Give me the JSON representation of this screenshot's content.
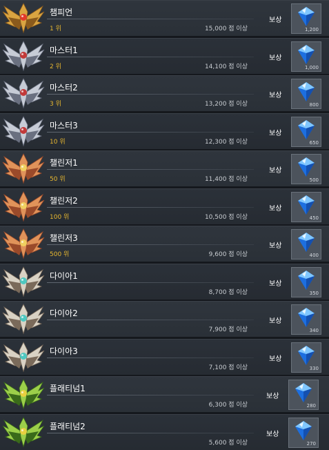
{
  "rows": [
    {
      "name": "챔피언",
      "rank": "1 위",
      "score": "15,000 점 이상",
      "reward": "보상",
      "qty": "1,200",
      "tier": "champion"
    },
    {
      "name": "마스터1",
      "rank": "2 위",
      "score": "14,100 점 이상",
      "reward": "보상",
      "qty": "1,000",
      "tier": "master"
    },
    {
      "name": "마스터2",
      "rank": "3 위",
      "score": "13,200 점 이상",
      "reward": "보상",
      "qty": "800",
      "tier": "master"
    },
    {
      "name": "마스터3",
      "rank": "10 위",
      "score": "12,300 점 이상",
      "reward": "보상",
      "qty": "650",
      "tier": "master"
    },
    {
      "name": "챌린저1",
      "rank": "50 위",
      "score": "11,400 점 이상",
      "reward": "보상",
      "qty": "500",
      "tier": "challenger"
    },
    {
      "name": "챌린저2",
      "rank": "100 위",
      "score": "10,500 점 이상",
      "reward": "보상",
      "qty": "450",
      "tier": "challenger"
    },
    {
      "name": "챌린저3",
      "rank": "500 위",
      "score": "9,600 점 이상",
      "reward": "보상",
      "qty": "400",
      "tier": "challenger"
    },
    {
      "name": "다이아1",
      "rank": "",
      "score": "8,700 점 이상",
      "reward": "보상",
      "qty": "350",
      "tier": "diamond"
    },
    {
      "name": "다이아2",
      "rank": "",
      "score": "7,900 점 이상",
      "reward": "보상",
      "qty": "340",
      "tier": "diamond"
    },
    {
      "name": "다이아3",
      "rank": "",
      "score": "7,100 점 이상",
      "reward": "보상",
      "qty": "330",
      "tier": "diamond"
    },
    {
      "name": "플래티넘1",
      "rank": "",
      "score": "6,300 점 이상",
      "reward": "보상",
      "qty": "280",
      "tier": "platinum"
    },
    {
      "name": "플래티넘2",
      "rank": "",
      "score": "5,600 점 이상",
      "reward": "보상",
      "qty": "270",
      "tier": "platinum"
    }
  ],
  "tier_colors": {
    "champion": {
      "wing": "#d9a441",
      "wing2": "#8a5a1c",
      "gem": "#e23a2a"
    },
    "master": {
      "wing": "#c7ccd6",
      "wing2": "#6a7080",
      "gem": "#c23a3a"
    },
    "challenger": {
      "wing": "#e0935a",
      "wing2": "#9a4a2a",
      "gem": "#f0d060"
    },
    "diamond": {
      "wing": "#d9d2c4",
      "wing2": "#7a6a5a",
      "gem": "#4ec8c0"
    },
    "platinum": {
      "wing": "#9ccf4a",
      "wing2": "#3a6a1a",
      "gem": "#e8d040"
    }
  },
  "icons": {
    "emblem": "rank-emblem-icon",
    "reward": "blue-diamond-icon"
  }
}
